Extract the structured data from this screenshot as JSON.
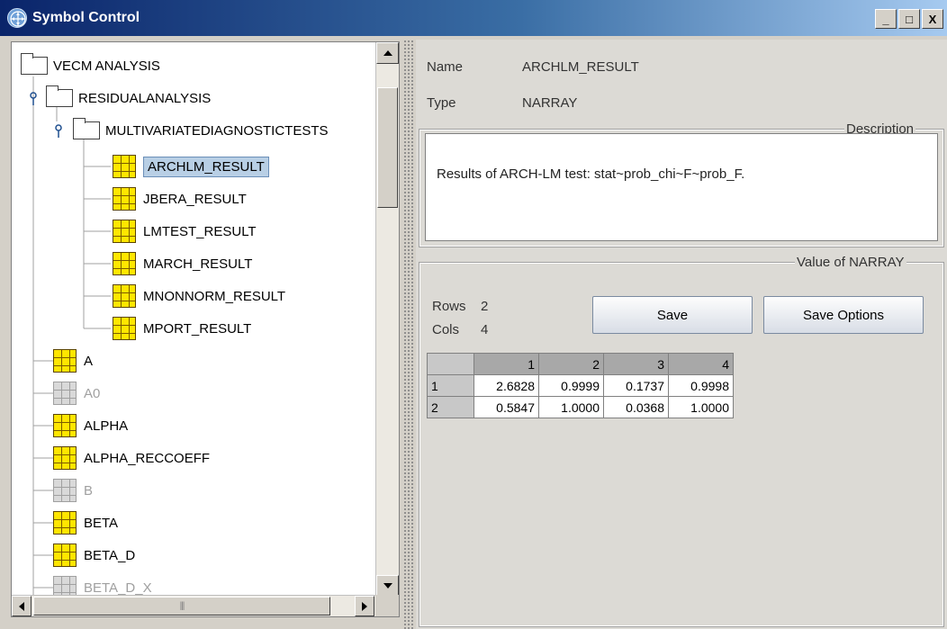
{
  "window": {
    "title": "Symbol Control",
    "buttons": [
      "_",
      "□",
      "X"
    ]
  },
  "tree": {
    "root": "VECM ANALYSIS",
    "group": "RESIDUALANALYSIS",
    "subgroup": "MULTIVARIATEDIAGNOSTICTESTS",
    "children": [
      "ARCHLM_RESULT",
      "JBERA_RESULT",
      "LMTEST_RESULT",
      "MARCH_RESULT",
      "MNONNORM_RESULT",
      "MPORT_RESULT"
    ],
    "selected": "ARCHLM_RESULT",
    "symbols": [
      {
        "label": "A",
        "enabled": true
      },
      {
        "label": "A0",
        "enabled": false
      },
      {
        "label": "ALPHA",
        "enabled": true
      },
      {
        "label": "ALPHA_RECCOEFF",
        "enabled": true
      },
      {
        "label": "B",
        "enabled": false
      },
      {
        "label": "BETA",
        "enabled": true
      },
      {
        "label": "BETA_D",
        "enabled": true
      },
      {
        "label": "BETA_D_X",
        "enabled": false
      }
    ]
  },
  "details": {
    "name_label": "Name",
    "name_value": "ARCHLM_RESULT",
    "type_label": "Type",
    "type_value": "NARRAY",
    "description_title": "Description",
    "description_text": "Results of ARCH-LM test: stat~prob_chi~F~prob_F.",
    "value_title": "Value of NARRAY",
    "rows_label": "Rows",
    "rows_value": "2",
    "cols_label": "Cols",
    "cols_value": "4",
    "save_label": "Save",
    "save_options_label": "Save Options"
  },
  "table": {
    "columns": [
      "1",
      "2",
      "3",
      "4"
    ],
    "rows": [
      {
        "header": "1",
        "values": [
          "2.6828",
          "0.9999",
          "0.1737",
          "0.9998"
        ]
      },
      {
        "header": "2",
        "values": [
          "0.5847",
          "1.0000",
          "0.0368",
          "1.0000"
        ]
      }
    ]
  }
}
